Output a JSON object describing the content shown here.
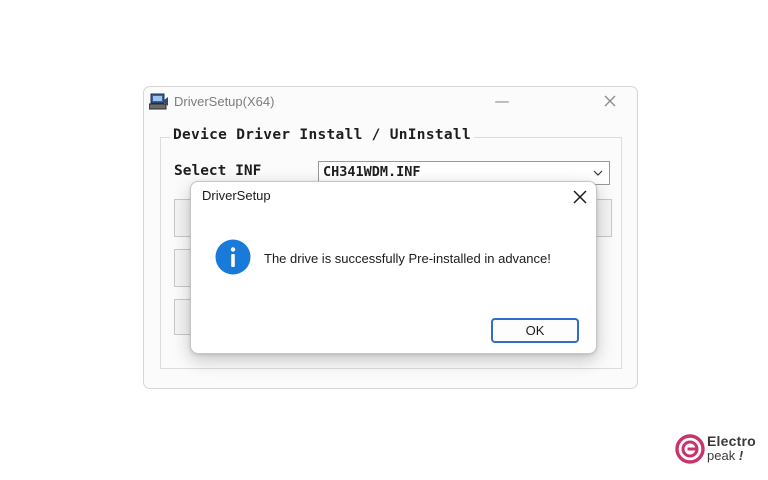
{
  "main_window": {
    "title": "DriverSetup(X64)",
    "minimize_glyph": "—",
    "group_caption": "Device Driver Install / UnInstall",
    "select_label": "Select INF",
    "inf_selected": "CH341WDM.INF",
    "icons": {
      "app": "driver-setup-app-icon",
      "close": "close-icon",
      "dropdown": "chevron-down-icon"
    }
  },
  "dialog": {
    "title": "DriverSetup",
    "message": "The drive is successfully Pre-installed in advance!",
    "ok_label": "OK",
    "icons": {
      "info": "info-icon",
      "close": "close-icon"
    }
  },
  "watermark": {
    "line1": "Electro",
    "line2_text": "peak",
    "line2_mark": "!",
    "brand_color": "#c8336b"
  },
  "colors": {
    "accent_blue": "#2d6fc8",
    "info_blue": "#1a7ad9"
  }
}
